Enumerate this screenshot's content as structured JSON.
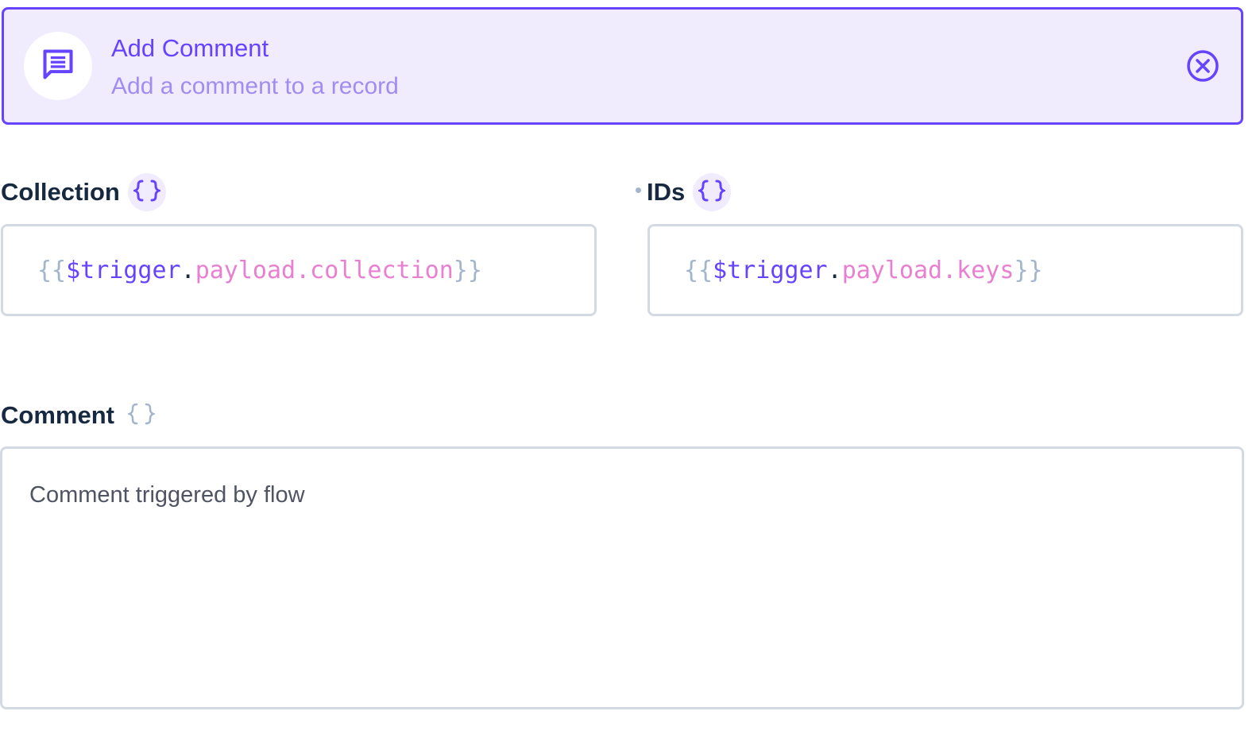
{
  "header": {
    "title": "Add Comment",
    "subtitle": "Add a comment to a record",
    "icon": "comment-icon",
    "close_icon": "close-circle-icon",
    "accent_color": "#6644ff",
    "background_color": "#f0ecfd"
  },
  "fields": {
    "collection": {
      "label": "Collection",
      "toggle_icon": "raw-value-braces-icon",
      "value": {
        "open_brace": "{{",
        "trigger": "$trigger",
        "dot": ".",
        "path": "payload.collection",
        "close_brace": "}}"
      }
    },
    "ids": {
      "label": "IDs",
      "required": true,
      "toggle_icon": "raw-value-braces-icon",
      "value": {
        "open_brace": "{{",
        "trigger": "$trigger",
        "dot": ".",
        "path": "payload.keys",
        "close_brace": "}}"
      }
    },
    "comment": {
      "label": "Comment",
      "toggle_icon": "raw-value-braces-icon",
      "value": "Comment triggered by flow"
    }
  },
  "colors": {
    "brace": "#a2b5cd",
    "trigger": "#6644ff",
    "path": "#e97fd0",
    "border": "#d3dae4"
  }
}
